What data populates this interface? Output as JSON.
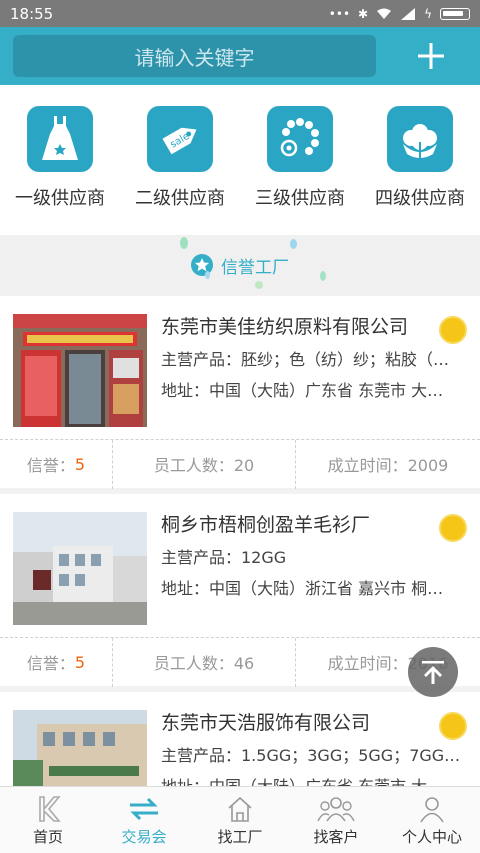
{
  "status": {
    "time": "18:55"
  },
  "search": {
    "placeholder": "请输入关键字"
  },
  "categories": [
    {
      "label": "一级供应商",
      "icon": "dress-icon"
    },
    {
      "label": "二级供应商",
      "icon": "sale-tag-icon"
    },
    {
      "label": "三级供应商",
      "icon": "beads-icon"
    },
    {
      "label": "四级供应商",
      "icon": "cotton-flower-icon"
    }
  ],
  "section": {
    "title": "信誉工厂"
  },
  "factories": [
    {
      "name": "东莞市美佳纺织原料有限公司",
      "products": "主营产品：胚纱；色（纺）纱；粘胶（…",
      "address": "地址：中国（大陆）广东省 东莞市 大…",
      "credit_label": "信誉：",
      "credit": "5",
      "staff": "员工人数：20",
      "founded": "成立时间：2009"
    },
    {
      "name": "桐乡市梧桐创盈羊毛衫厂",
      "products": "主营产品：12GG",
      "address": "地址：中国（大陆）浙江省 嘉兴市 桐…",
      "credit_label": "信誉：",
      "credit": "5",
      "staff": "员工人数：46",
      "founded": "成立时间：2016"
    },
    {
      "name": "东莞市天浩服饰有限公司",
      "products": "主营产品：1.5GG；3GG；5GG；7GG…",
      "address": "地址：中国（大陆）广东省 东莞市 大…"
    }
  ],
  "tabs": [
    {
      "label": "首页"
    },
    {
      "label": "交易会"
    },
    {
      "label": "找工厂"
    },
    {
      "label": "找客户"
    },
    {
      "label": "个人中心"
    }
  ],
  "colors": {
    "accent": "#35aec8",
    "credit": "#f0650f",
    "medal": "#f5c518"
  }
}
